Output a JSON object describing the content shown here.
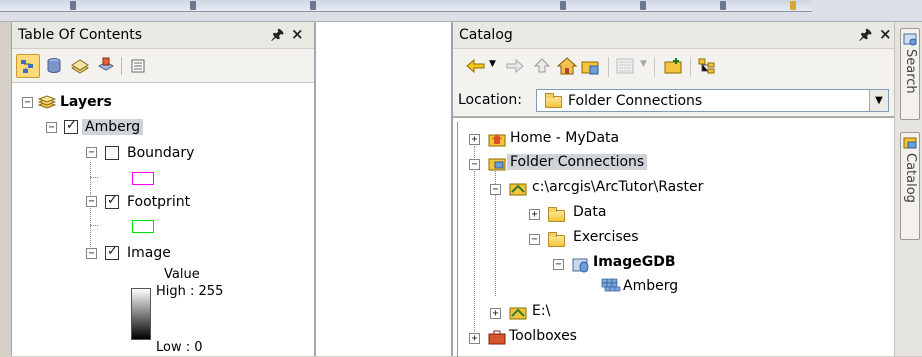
{
  "toc": {
    "title": "Table Of Contents",
    "pin_glyph": "p",
    "close_glyph": "×",
    "tools": [
      "list-by-drawing-order-icon",
      "list-by-source-icon",
      "list-by-visibility-icon",
      "list-by-selection-icon",
      "options-icon"
    ],
    "layers_label": "Layers",
    "frame_label": "Amberg",
    "boundary_label": "Boundary",
    "footprint_label": "Footprint",
    "image_label": "Image",
    "legend_value": "Value",
    "legend_high": "High : 255",
    "legend_low": "Low : 0",
    "boundary_color": "#ff00ff",
    "footprint_color": "#00dd00"
  },
  "catalog": {
    "title": "Catalog",
    "close_glyph": "×",
    "location_label": "Location:",
    "location_value": "Folder Connections",
    "tree": {
      "home": "Home - MyData",
      "folder_connections": "Folder Connections",
      "raster_path": "c:\\arcgis\\ArcTutor\\Raster",
      "data": "Data",
      "exercises": "Exercises",
      "gdb": "ImageGDB",
      "raster": "Amberg",
      "drive_e": "E:\\",
      "toolboxes": "Toolboxes"
    }
  },
  "dock": {
    "search_tab": "Search",
    "catalog_tab": "Catalog"
  }
}
